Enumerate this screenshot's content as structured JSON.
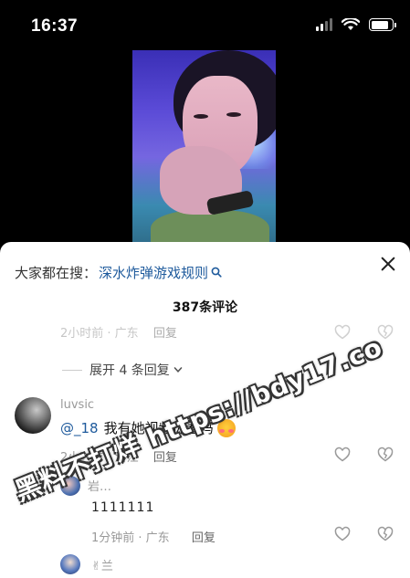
{
  "status_bar": {
    "time": "16:37",
    "battery_level": 0.85
  },
  "video": {
    "icon": "video-thumbnail"
  },
  "sheet": {
    "search_prefix": "大家都在搜：",
    "search_query": "深水炸弹游戏规则",
    "comment_count": "387条评论"
  },
  "comments": {
    "prev_meta_time": "2小时前 · 广东",
    "reply_label": "回复",
    "expand_label": "展开 4 条回复",
    "main": {
      "username": "luvsic",
      "mention": "@_18",
      "text": "我有她视频你看吗",
      "time": "2小时前 · 浙江"
    },
    "sub1": {
      "username": "岩…",
      "text": "1111111",
      "time": "1分钟前 · 广东"
    },
    "sub2": {
      "username": "✌兰"
    }
  },
  "watermark": "黑料不打烊 https://bdy17.co"
}
